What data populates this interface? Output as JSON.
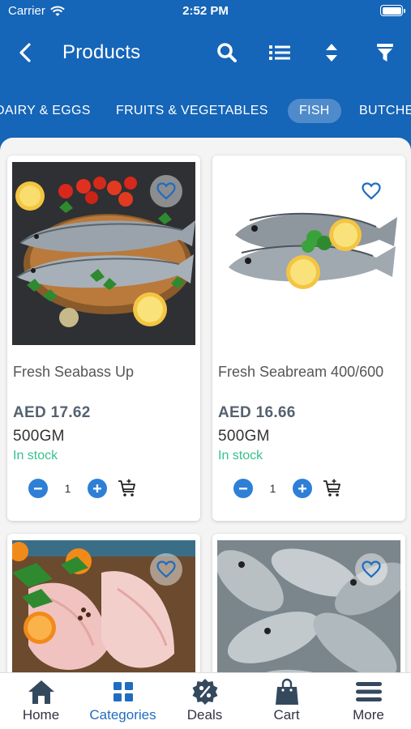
{
  "status_bar": {
    "carrier": "Carrier",
    "time": "2:52 PM"
  },
  "header": {
    "title": "Products"
  },
  "tabs": [
    {
      "label": "DAIRY & EGGS"
    },
    {
      "label": "FRUITS & VEGETABLES"
    },
    {
      "label": "FISH",
      "active": true
    },
    {
      "label": "BUTCHERY"
    }
  ],
  "products": [
    {
      "name": "Fresh Seabass  Up",
      "price": "AED 17.62",
      "unit": "500GM",
      "stock": "In stock",
      "qty": "1"
    },
    {
      "name": "Fresh Seabream 400/600",
      "price": "AED 16.66",
      "unit": "500GM",
      "stock": "In stock",
      "qty": "1"
    },
    {
      "name": "",
      "price": "",
      "unit": "",
      "stock": "",
      "qty": ""
    },
    {
      "name": "",
      "price": "",
      "unit": "",
      "stock": "",
      "qty": ""
    }
  ],
  "bottom_nav": [
    {
      "label": "Home",
      "icon": "home-icon"
    },
    {
      "label": "Categories",
      "icon": "categories-icon",
      "active": true
    },
    {
      "label": "Deals",
      "icon": "deals-icon"
    },
    {
      "label": "Cart",
      "icon": "cart-icon"
    },
    {
      "label": "More",
      "icon": "menu-icon"
    }
  ],
  "colors": {
    "primary": "#1565b8",
    "accent": "#2e7fd6",
    "stock": "#36c28d",
    "price": "#556270"
  }
}
